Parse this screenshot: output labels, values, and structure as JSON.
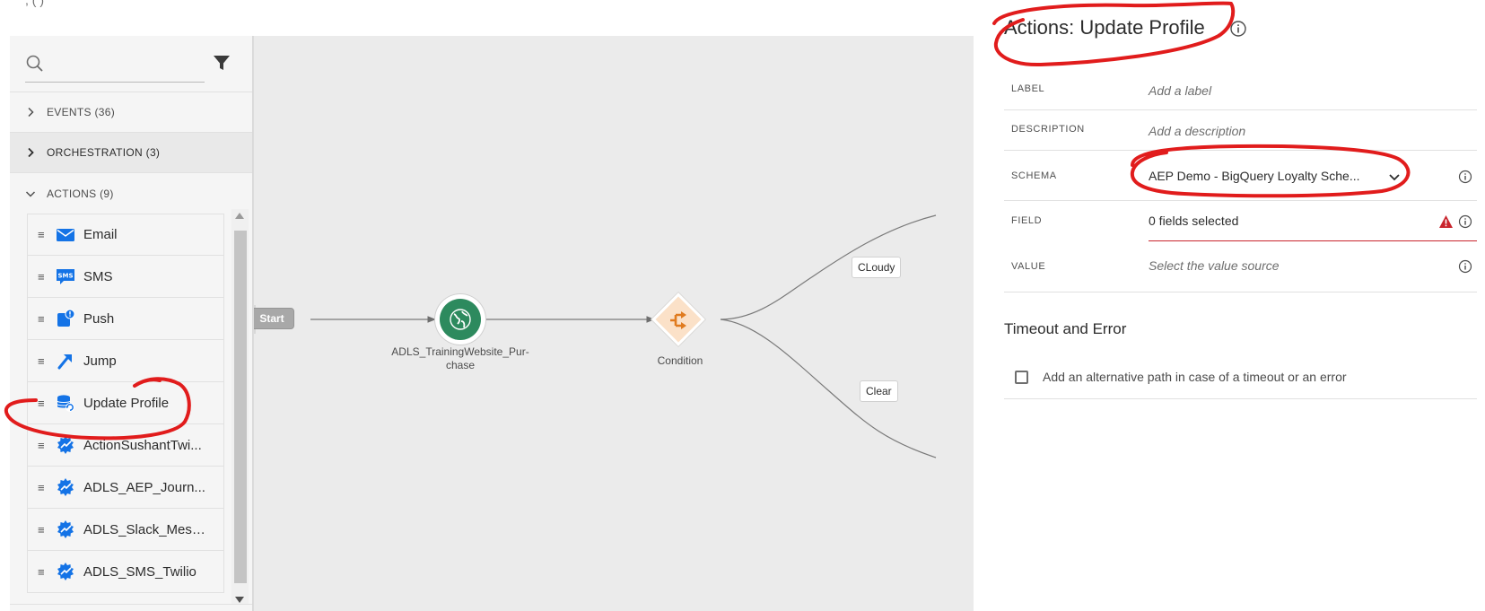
{
  "palette": {
    "search": {
      "value": "",
      "placeholder": ""
    },
    "groups": {
      "events": "EVENTS (36)",
      "orchestration": "ORCHESTRATION (3)",
      "actions": "ACTIONS (9)"
    },
    "actions": [
      {
        "label": "Email",
        "icon": "email-icon"
      },
      {
        "label": "SMS",
        "icon": "sms-icon"
      },
      {
        "label": "Push",
        "icon": "push-icon"
      },
      {
        "label": "Jump",
        "icon": "jump-icon"
      },
      {
        "label": "Update Profile",
        "icon": "update-profile-icon"
      },
      {
        "label": "ActionSushantTwi...",
        "icon": "custom-action-icon"
      },
      {
        "label": "ADLS_AEP_Journ...",
        "icon": "custom-action-icon"
      },
      {
        "label": "ADLS_Slack_Mess...",
        "icon": "custom-action-icon"
      },
      {
        "label": "ADLS_SMS_Twilio",
        "icon": "custom-action-icon"
      }
    ]
  },
  "canvas": {
    "start_label": "Start",
    "event_node": {
      "label_line1": "ADLS_TrainingWebsite_Pur-",
      "label_line2": "chase",
      "color": "#2d8a5e"
    },
    "condition_node": {
      "label": "Condition",
      "color": "#e07b1f"
    },
    "paths": {
      "cloudy": "CLoudy",
      "clear": "Clear"
    }
  },
  "inspector": {
    "title": "Actions: Update Profile",
    "rows": {
      "label": {
        "key": "LABEL",
        "placeholder": "Add a label"
      },
      "description": {
        "key": "DESCRIPTION",
        "placeholder": "Add a description"
      },
      "schema": {
        "key": "SCHEMA",
        "value": "AEP Demo - BigQuery Loyalty Sche..."
      },
      "field": {
        "key": "FIELD",
        "value": "0 fields selected"
      },
      "value": {
        "key": "VALUE",
        "placeholder": "Select the value source"
      }
    },
    "timeout_heading": "Timeout and Error",
    "alt_path_label": "Add an alternative path in case of a timeout or an error",
    "alt_path_checked": false
  },
  "colors": {
    "accent_blue": "#1473e6",
    "error_red": "#c9252d",
    "annotation_red": "#e11c1c"
  }
}
